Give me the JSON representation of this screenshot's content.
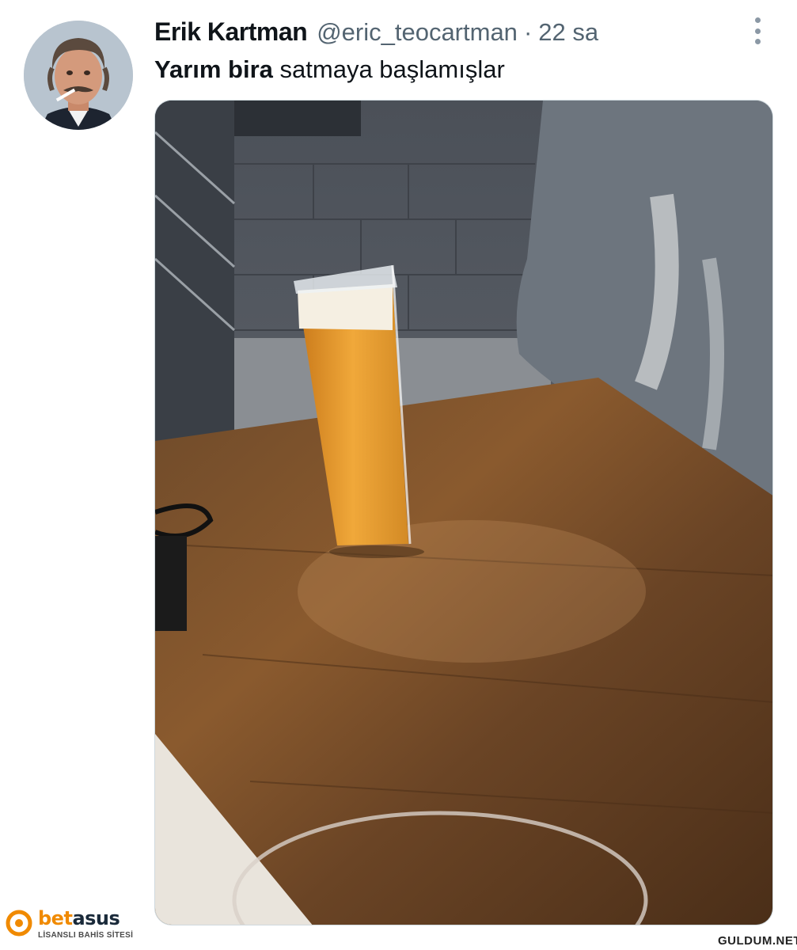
{
  "tweet": {
    "display_name": "Erik Kartman",
    "handle": "@eric_teocartman",
    "separator": "·",
    "time": "22 sa",
    "text_bold": "Yarım bira",
    "text_rest": " satmaya başlamışlar"
  },
  "watermarks": {
    "left_brand_main": "bet",
    "left_brand_accent": "asus",
    "left_tagline": "LİSANSLI BAHİS SİTESİ",
    "right": "GULDUM.NET"
  },
  "icons": {
    "more": "more-vertical-icon",
    "brand": "betasus-logo-icon"
  },
  "colors": {
    "text_primary": "#0f1419",
    "text_secondary": "#536471",
    "brand_orange": "#f08a00"
  }
}
